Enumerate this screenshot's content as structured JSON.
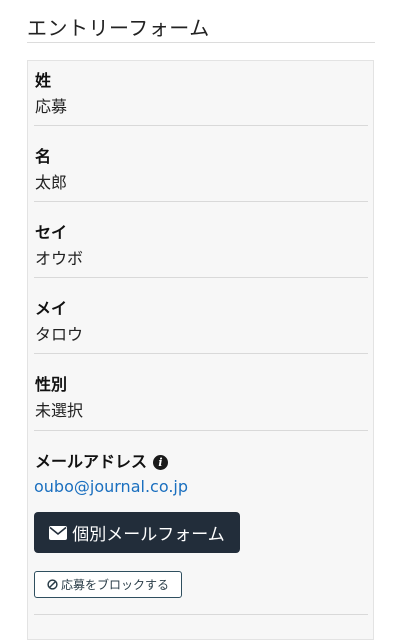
{
  "page": {
    "title": "エントリーフォーム"
  },
  "fields": [
    {
      "label": "姓",
      "value": "応募"
    },
    {
      "label": "名",
      "value": "太郎"
    },
    {
      "label": "セイ",
      "value": "オウボ"
    },
    {
      "label": "メイ",
      "value": "タロウ"
    },
    {
      "label": "性別",
      "value": "未選択"
    }
  ],
  "email": {
    "label": "メールアドレス",
    "info_icon": "info-circle-icon",
    "value": "oubo@journal.co.jp"
  },
  "actions": {
    "mail_button_label": "個別メールフォーム",
    "mail_button_icon": "envelope-icon",
    "block_button_label": "応募をブロックする",
    "block_button_icon": "ban-icon"
  },
  "colors": {
    "link": "#1a6fbf",
    "primary_button": "#222d3a",
    "panel_bg": "#f7f7f7"
  }
}
